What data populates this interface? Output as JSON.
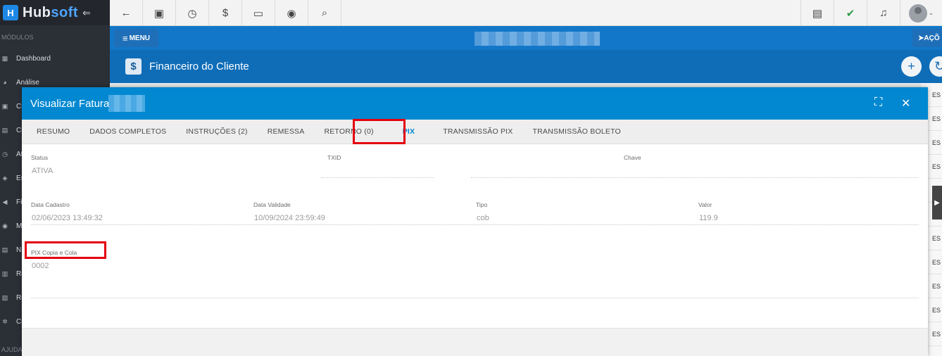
{
  "brand": {
    "name_a": "Hub",
    "name_b": "soft",
    "logo_letter": "H",
    "collapse_glyph": "⇐"
  },
  "sidebar": {
    "section_label": "MÓDULOS",
    "items": [
      {
        "label": "Dashboard",
        "icon": "▦"
      },
      {
        "label": "Análise",
        "icon": "◕"
      },
      {
        "label": "Cl",
        "icon": "▣"
      },
      {
        "label": "Cl",
        "icon": "▤"
      },
      {
        "label": "At",
        "icon": "◷"
      },
      {
        "label": "Es",
        "icon": "◈"
      },
      {
        "label": "Fi",
        "icon": "◀"
      },
      {
        "label": "M",
        "icon": "◉"
      },
      {
        "label": "N",
        "icon": "▤"
      },
      {
        "label": "Re",
        "icon": "▥"
      },
      {
        "label": "Re",
        "icon": "▧"
      },
      {
        "label": "Co",
        "icon": "✲"
      }
    ],
    "help_label": "AJUDA"
  },
  "topbar": {
    "icons": [
      "←",
      "▣",
      "◷",
      "$",
      "▭",
      "◉",
      "⌕"
    ],
    "right_icons": [
      "▤",
      "✔",
      "♫"
    ],
    "avatar_caret": "⌄"
  },
  "header": {
    "menu_label": "MENU",
    "menu_glyph": "≡",
    "acoes_label": "AÇÕ",
    "acoes_glyph": "➤"
  },
  "subheader": {
    "icon": "$",
    "title": "Financeiro do Cliente",
    "add_glyph": "+",
    "refresh_glyph": "↻"
  },
  "modal": {
    "title": "Visualizar Fatura",
    "expand_glyph": "⛶",
    "close_glyph": "✕",
    "tabs": [
      "RESUMO",
      "DADOS COMPLETOS",
      "INSTRUÇÕES (2)",
      "REMESSA",
      "RETORNO (0)",
      "PIX",
      "TRANSMISSÃO PIX",
      "TRANSMISSÃO BOLETO"
    ],
    "active_tab_index": 5,
    "fields": {
      "status": {
        "label": "Status",
        "value": "ATIVA"
      },
      "txid": {
        "label": "TXID",
        "value": ""
      },
      "chave": {
        "label": "Chave",
        "value": ""
      },
      "data_cadastro": {
        "label": "Data Cadastro",
        "value": "02/06/2023 13:49:32"
      },
      "data_validade": {
        "label": "Data Validade",
        "value": "10/09/2024 23:59:49"
      },
      "tipo": {
        "label": "Tipo",
        "value": "cob"
      },
      "valor": {
        "label": "Valor",
        "value": "119.9"
      },
      "pix_copia_cola": {
        "label": "PIX Copia e Cola",
        "value": "0002"
      }
    }
  },
  "background_rows": [
    "ES",
    "ES",
    "ES",
    "ES",
    "ES",
    "ES",
    "ES",
    "ES",
    "ES",
    "ES",
    "ES"
  ],
  "colors": {
    "accent": "#0288d1",
    "highlight": "#e3000f",
    "sidebar": "#2b2f36"
  }
}
